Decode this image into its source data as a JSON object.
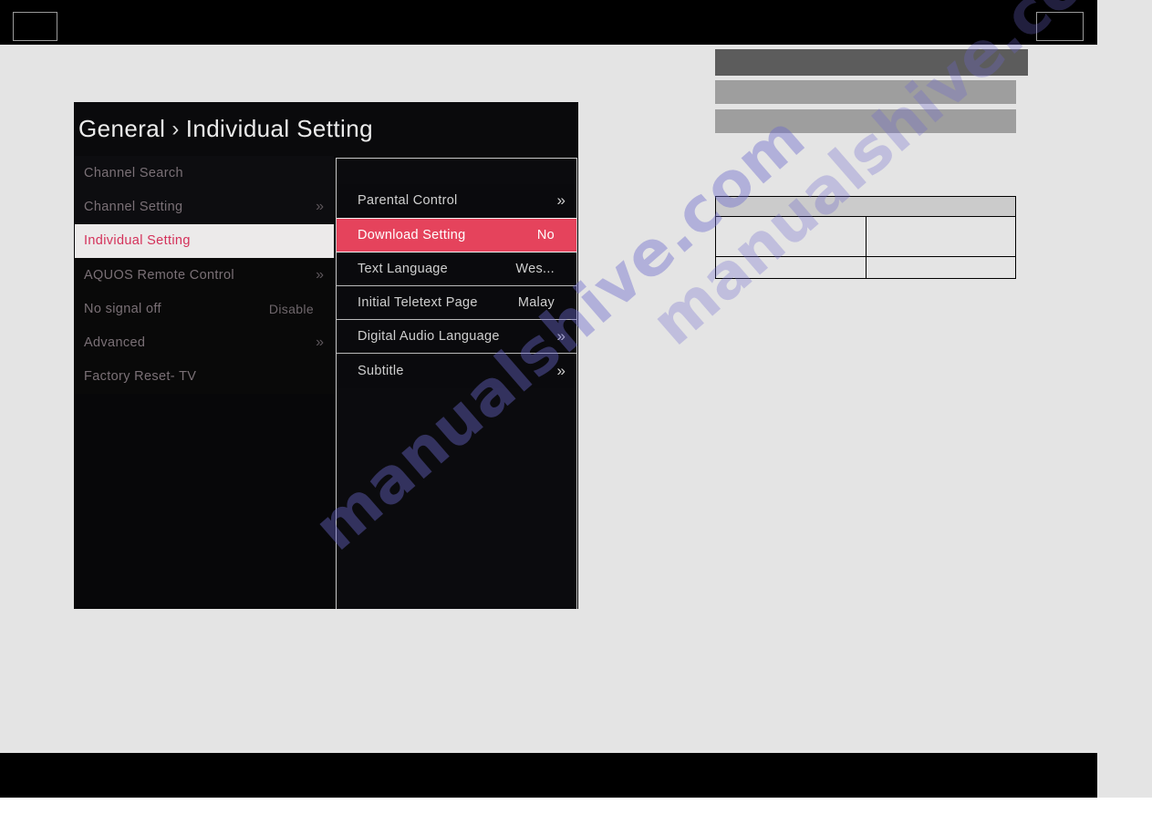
{
  "page": {
    "background_color": "#e4e4e4",
    "watermark_text": "manualshive.com",
    "watermark_color": "#6c68cd"
  },
  "top_band": {
    "background_color": "#000000",
    "left_box_label": "",
    "right_box_label": ""
  },
  "bottom_band": {
    "background_color": "#000000"
  },
  "gray_bars": [
    {
      "color": "#5c5c5c",
      "text": ""
    },
    {
      "color": "#9e9e9e",
      "text": ""
    },
    {
      "color": "#9e9e9e",
      "text": ""
    }
  ],
  "data_table": {
    "header": [
      ""
    ],
    "rows": [
      [
        "",
        ""
      ],
      [
        "",
        ""
      ]
    ]
  },
  "osd": {
    "title": {
      "parent": "General",
      "separator": "›",
      "current": "Individual Setting"
    },
    "accent_color": "#e5435c",
    "selected_color": "#d4315a",
    "main_menu": [
      {
        "label": "Channel Search",
        "value": "",
        "chevron": ""
      },
      {
        "label": "Channel Setting",
        "value": "",
        "chevron": "»"
      },
      {
        "label": "Individual Setting",
        "value": "",
        "chevron": "",
        "selected": true
      },
      {
        "label": "AQUOS Remote Control",
        "value": "",
        "chevron": "»"
      },
      {
        "label": "No signal off",
        "value": "Disable",
        "chevron": ""
      },
      {
        "label": "Advanced",
        "value": "",
        "chevron": "»"
      },
      {
        "label": "Factory Reset- TV",
        "value": "",
        "chevron": ""
      }
    ],
    "sub_menu": [
      {
        "label": "Parental Control",
        "value": "",
        "chevron": "»"
      },
      {
        "label": "Download Setting",
        "value": "No",
        "chevron": "",
        "highlight": true
      },
      {
        "label": "Text Language",
        "value": "Wes...",
        "chevron": ""
      },
      {
        "label": "Initial Teletext Page",
        "value": "Malay",
        "chevron": ""
      },
      {
        "label": "Digital Audio Language",
        "value": "",
        "chevron": "»"
      },
      {
        "label": "Subtitle",
        "value": "",
        "chevron": "»"
      }
    ]
  }
}
